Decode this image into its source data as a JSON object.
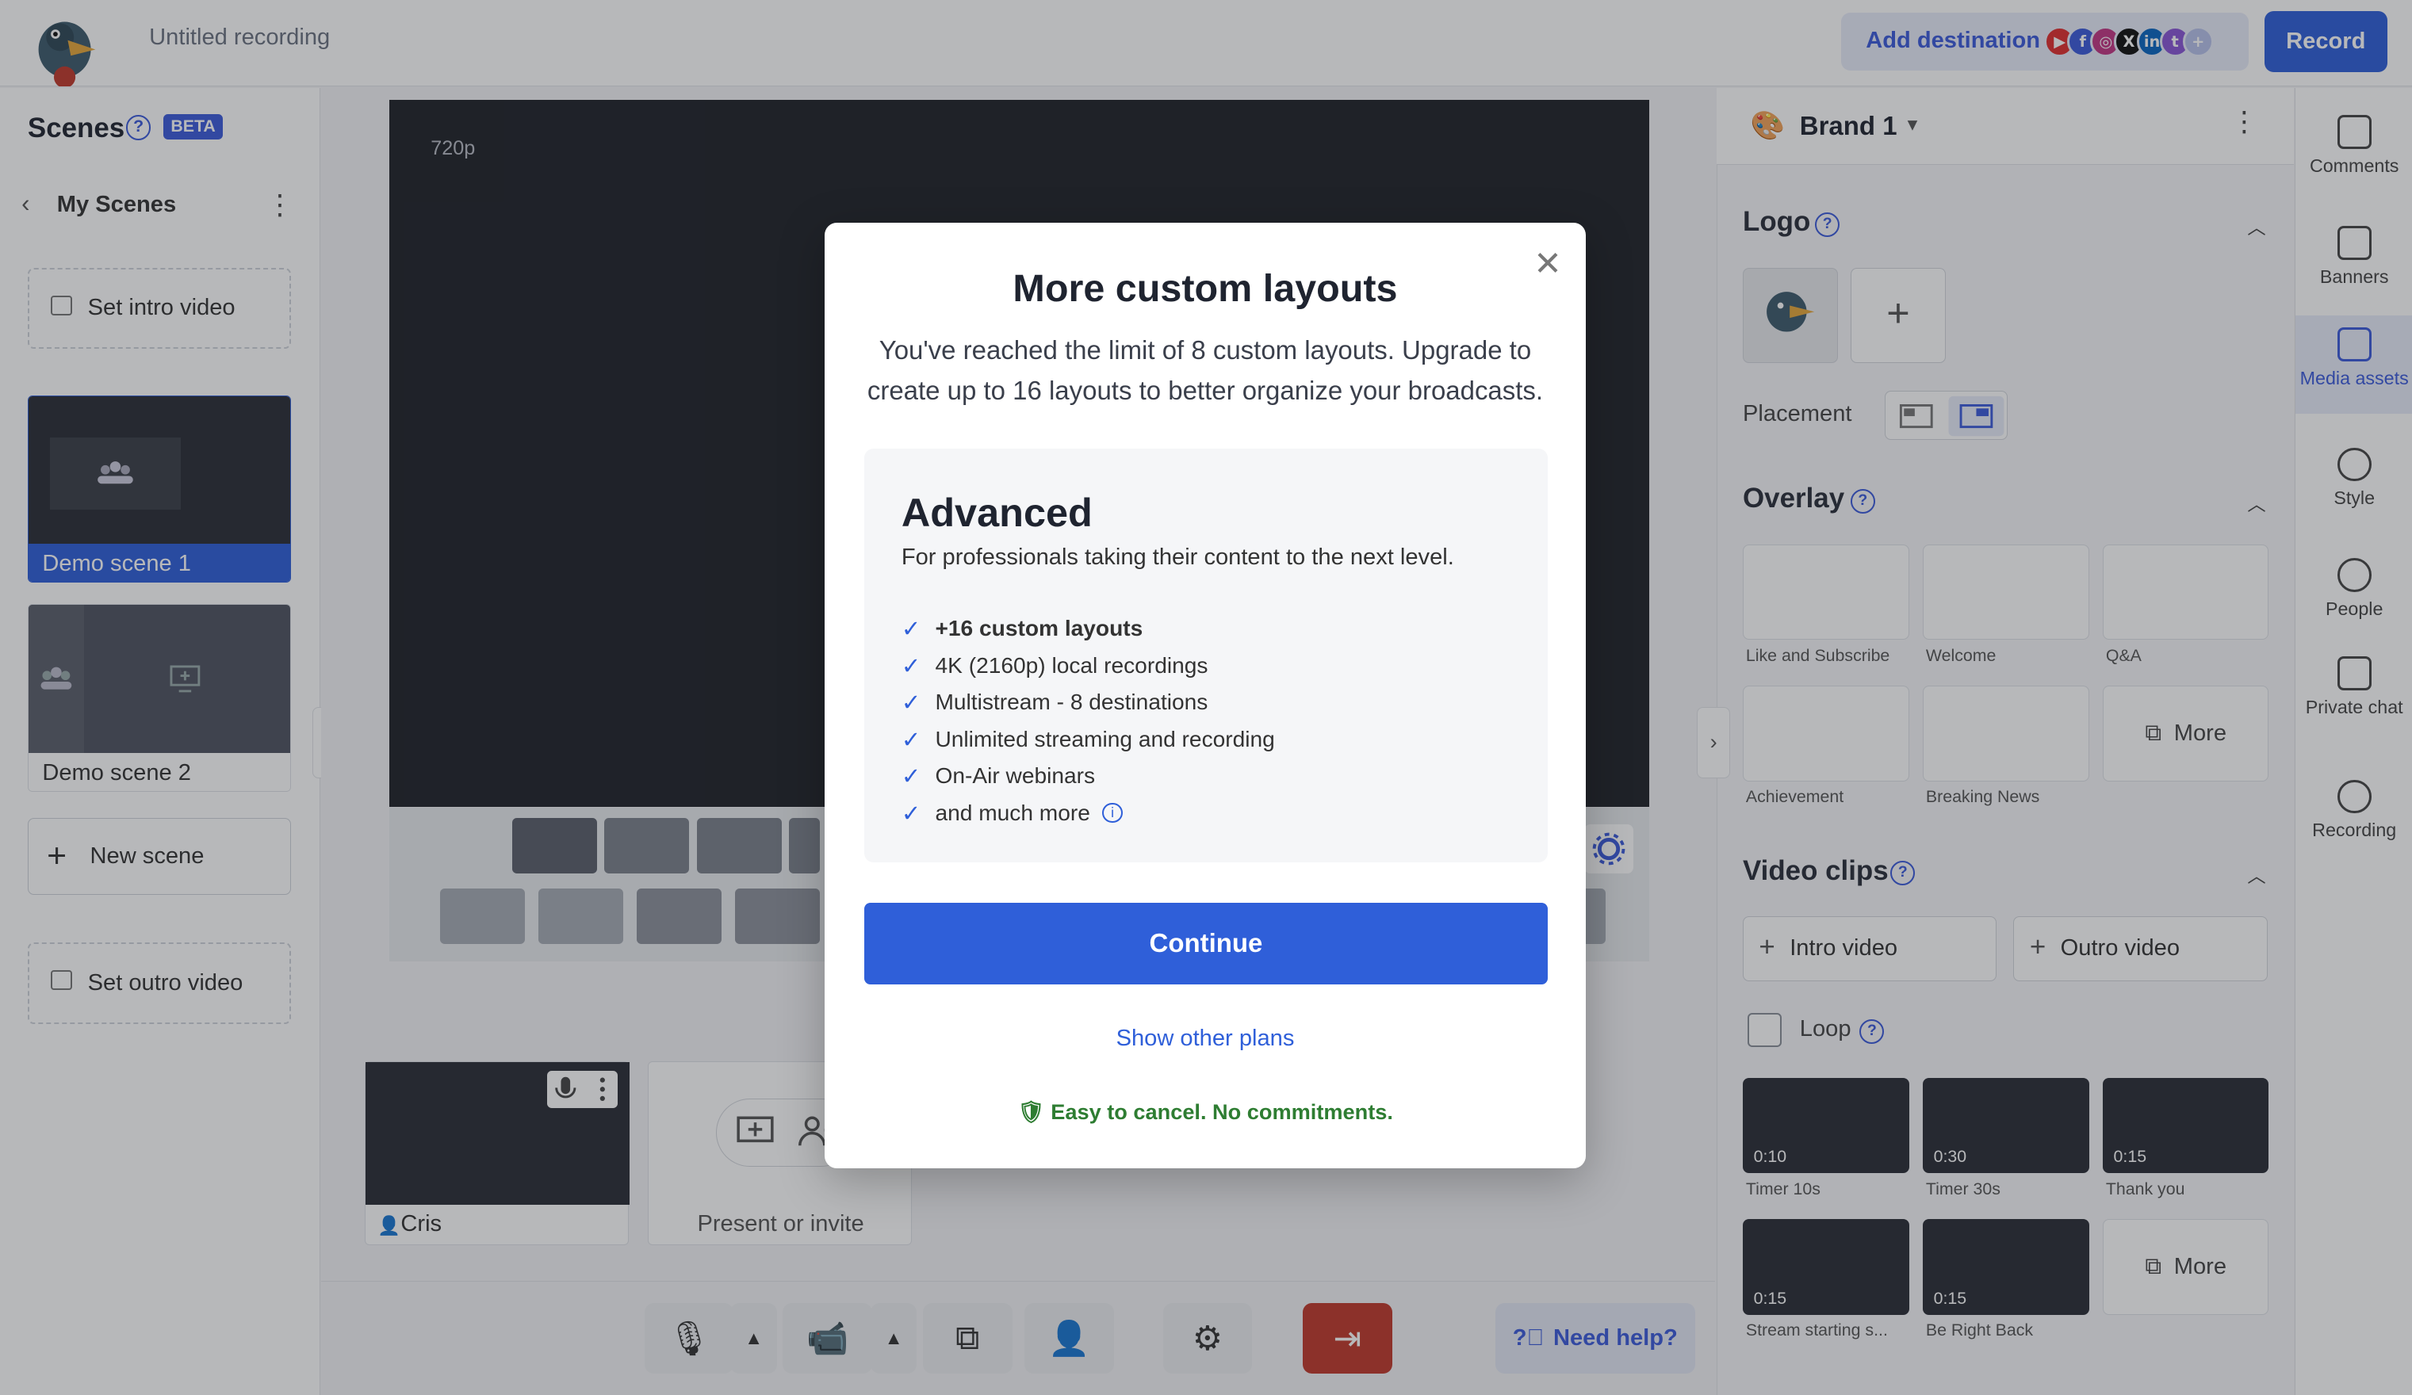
{
  "header": {
    "recording_title": "Untitled recording",
    "add_destination": "Add destination",
    "record": "Record",
    "destinations": [
      {
        "icon": "youtube-icon",
        "color": "#e02f2f",
        "glyph": "▶"
      },
      {
        "icon": "facebook-icon",
        "color": "#3b5bdb",
        "glyph": "f"
      },
      {
        "icon": "instagram-icon",
        "color": "#c13584",
        "glyph": "◎"
      },
      {
        "icon": "x-icon",
        "color": "#111111",
        "glyph": "X"
      },
      {
        "icon": "linkedin-icon",
        "color": "#0a66c2",
        "glyph": "in"
      },
      {
        "icon": "twitch-icon",
        "color": "#8a56d6",
        "glyph": "t"
      },
      {
        "icon": "add-icon",
        "color": "#b7c2ea",
        "glyph": "+"
      }
    ]
  },
  "scenes": {
    "title": "Scenes",
    "beta": "BETA",
    "my_scenes": "My Scenes",
    "set_intro": "Set intro video",
    "scene1": "Demo scene 1",
    "scene2": "Demo scene 2",
    "new_scene": "New scene",
    "set_outro": "Set outro video"
  },
  "stage": {
    "resolution": "720p",
    "participant_name": "Cris",
    "present_invite": "Present or invite"
  },
  "bottom": {
    "need_help": "Need help?"
  },
  "right": {
    "brand": "Brand 1",
    "logo": "Logo",
    "placement": "Placement",
    "overlay": "Overlay",
    "overlays": [
      "Like and Subscribe",
      "Welcome",
      "Q&A",
      "Achievement",
      "Breaking News"
    ],
    "more": "More",
    "video_clips": "Video clips",
    "intro_video": "Intro video",
    "outro_video": "Outro video",
    "loop": "Loop",
    "clips": [
      {
        "dur": "0:10",
        "label": "Timer 10s"
      },
      {
        "dur": "0:30",
        "label": "Timer 30s"
      },
      {
        "dur": "0:15",
        "label": "Thank you"
      },
      {
        "dur": "0:15",
        "label": "Stream starting s..."
      },
      {
        "dur": "0:15",
        "label": "Be Right Back"
      }
    ]
  },
  "rail": {
    "comments": "Comments",
    "banners": "Banners",
    "media_assets": "Media assets",
    "style": "Style",
    "people": "People",
    "private_chat": "Private chat",
    "recording": "Recording"
  },
  "modal": {
    "title": "More custom layouts",
    "description": "You've reached the limit of 8 custom layouts. Upgrade to create up to 16 layouts to better organize your broadcasts.",
    "plan_name": "Advanced",
    "plan_sub": "For professionals taking their content to the next level.",
    "features": [
      "+16 custom layouts",
      "4K (2160p) local recordings",
      "Multistream - 8 destinations",
      "Unlimited streaming and recording",
      "On-Air webinars",
      "and much more"
    ],
    "continue": "Continue",
    "show_other_plans": "Show other plans",
    "cancel_note": "Easy to cancel. No commitments."
  },
  "colors": {
    "accent": "#2f5fd9",
    "success": "#2e7d32",
    "danger": "#c0392b"
  }
}
